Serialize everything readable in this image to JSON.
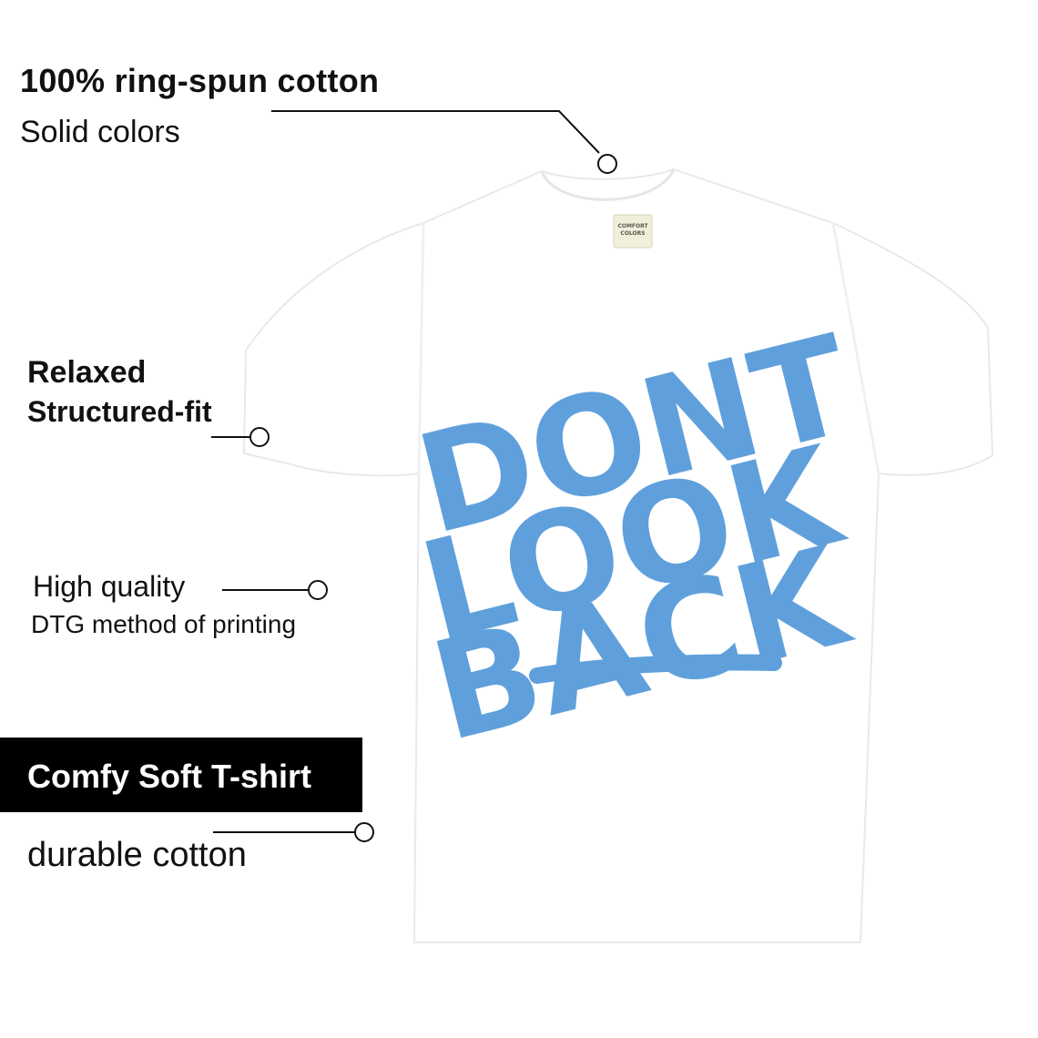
{
  "features": {
    "cotton_title": "100% ring-spun cotton",
    "cotton_sub": "Solid colors",
    "fit_title": "Relaxed",
    "fit_sub": "Structured-fit",
    "print_title": "High quality",
    "print_sub": "DTG method of printing",
    "badge_label": "Comfy Soft T-shirt",
    "durable": "durable cotton"
  },
  "shirt": {
    "color": "#ffffff",
    "print_color": "#5fa0dc",
    "print_lines": [
      "DONT",
      "LOOK",
      "BACK"
    ],
    "tag_lines": [
      "COMFORT",
      "COLORS"
    ]
  }
}
